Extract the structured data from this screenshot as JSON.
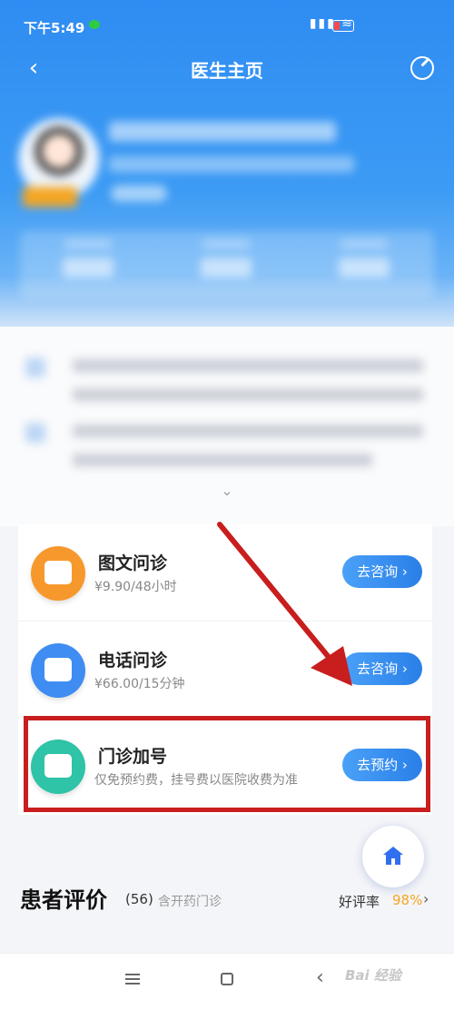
{
  "status_bar": {
    "time": "下午5:49",
    "battery": "40"
  },
  "nav": {
    "title": "医生主页"
  },
  "services": [
    {
      "title": "图文问诊",
      "price": "¥9.90/48小时",
      "button": "去咨询",
      "icon": "chat-icon",
      "color": "#f7982c"
    },
    {
      "title": "电话问诊",
      "price": "¥66.00/15分钟",
      "button": "去咨询",
      "icon": "phone-icon",
      "color": "#3f8cf2"
    },
    {
      "title": "门诊加号",
      "price": "仅免预约费，挂号费以医院收费为准",
      "button": "去预约",
      "icon": "calendar-icon",
      "color": "#2fc3a8"
    }
  ],
  "reviews": {
    "title": "患者评价",
    "count": "(56)",
    "note": "含开药门诊",
    "rating_label": "好评率",
    "rating_value": "98%"
  },
  "watermark": "Bai 经验"
}
